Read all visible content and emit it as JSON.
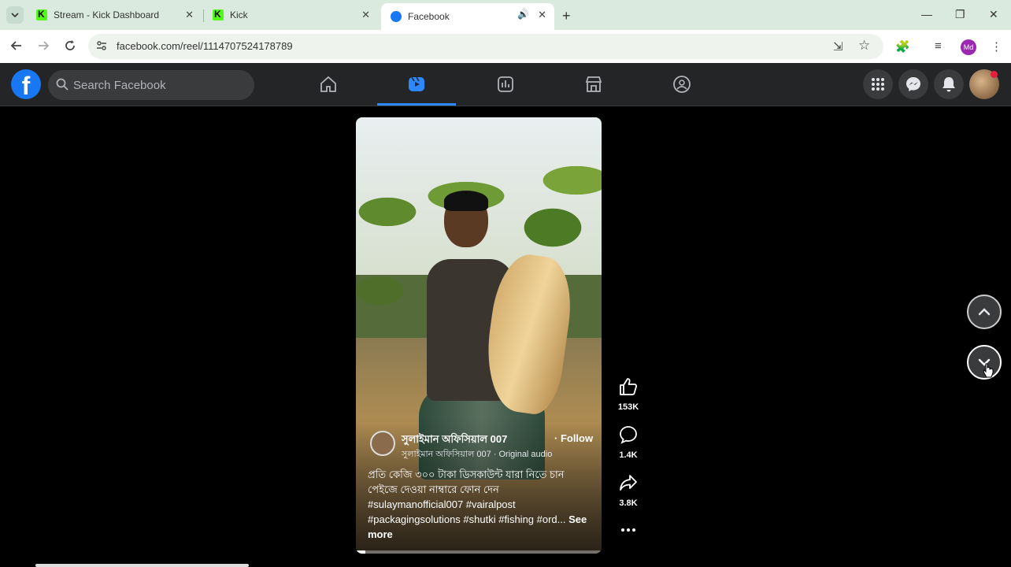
{
  "browser": {
    "tabs": [
      {
        "title": "Stream - Kick Dashboard"
      },
      {
        "title": "Kick"
      },
      {
        "title": "Facebook"
      }
    ],
    "url": "facebook.com/reel/1114707524178789",
    "profile_initials": "Md"
  },
  "header": {
    "logo": "f",
    "search_placeholder": "Search Facebook",
    "nav_items": [
      "home-icon",
      "reels-icon",
      "stats-icon",
      "marketplace-icon",
      "groups-icon"
    ],
    "active_nav": "reels-icon"
  },
  "reel": {
    "author": "সুলাইমান অফিসিয়াল 007",
    "follow_label": "· Follow",
    "audio": "সুলাইমান অফিসিয়াল 007 · Original audio",
    "caption": "প্রতি কেজি ৩০০ টাকা ডিসকাউন্ট যারা নিতে চান পেইজে দেওয়া নাম্বারে ফোন দেন",
    "tags": "#sulaymanofficial007 #vairalpost #packagingsolutions #shutki #fishing #ord...",
    "see_more": "See more",
    "progress": 0.04
  },
  "actions": {
    "likes": "153K",
    "comments": "1.4K",
    "shares": "3.8K"
  },
  "colors": {
    "fb_blue": "#1877f2",
    "header_bg": "#242526",
    "active_underline": "#2d88ff"
  }
}
